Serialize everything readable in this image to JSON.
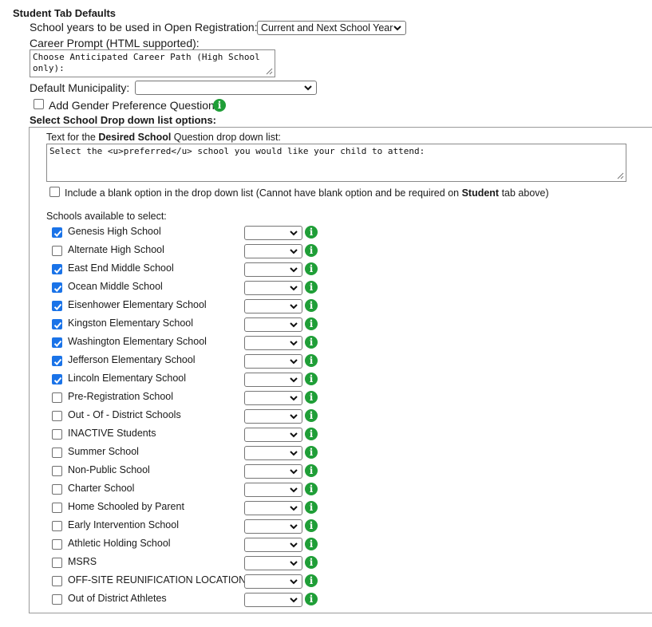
{
  "title": "Student Tab Defaults",
  "school_years": {
    "label": "School years to be used in Open Registration:",
    "selected": "Current and Next School Year"
  },
  "career_prompt": {
    "label": "Career Prompt (HTML supported):",
    "value": "Choose Anticipated Career Path (High School only):"
  },
  "municipality": {
    "label": "Default Municipality:",
    "selected": ""
  },
  "gender_pref": {
    "label": "Add Gender Preference Question",
    "checked": false
  },
  "drop_down_heading": "Select School Drop down list options:",
  "desired_school": {
    "label_pre": "Text for the ",
    "label_bold": "Desired School",
    "label_post": " Question drop down list:",
    "value": "Select the <u>preferred</u> school you would like your child to attend:"
  },
  "blank_option": {
    "label_pre": "Include a blank option in the drop down list (Cannot have blank option and be required on ",
    "label_bold": "Student",
    "label_post": " tab above)",
    "checked": false
  },
  "schools_label": "Schools available to select:",
  "schools": [
    {
      "name": "Genesis High School",
      "checked": true
    },
    {
      "name": "Alternate High School",
      "checked": false
    },
    {
      "name": "East End Middle School",
      "checked": true
    },
    {
      "name": "Ocean Middle School",
      "checked": true
    },
    {
      "name": "Eisenhower Elementary School",
      "checked": true
    },
    {
      "name": "Kingston Elementary School",
      "checked": true
    },
    {
      "name": "Washington Elementary School",
      "checked": true
    },
    {
      "name": "Jefferson Elementary School",
      "checked": true
    },
    {
      "name": "Lincoln Elementary School",
      "checked": true
    },
    {
      "name": "Pre-Registration School",
      "checked": false
    },
    {
      "name": "Out - Of - District Schools",
      "checked": false
    },
    {
      "name": "INACTIVE Students",
      "checked": false
    },
    {
      "name": "Summer School",
      "checked": false
    },
    {
      "name": "Non-Public School",
      "checked": false
    },
    {
      "name": "Charter School",
      "checked": false
    },
    {
      "name": "Home Schooled by Parent",
      "checked": false
    },
    {
      "name": "Early Intervention School",
      "checked": false
    },
    {
      "name": "Athletic Holding School",
      "checked": false
    },
    {
      "name": "MSRS",
      "checked": false
    },
    {
      "name": "OFF-SITE REUNIFICATION LOCATION 1",
      "checked": false
    },
    {
      "name": "Out of District Athletes",
      "checked": false
    }
  ],
  "colors": {
    "accent": "#1a73e8",
    "info_green": "#1f9e37"
  },
  "icons": {
    "info": "info-icon",
    "dropdown": "chevron-down-icon",
    "check": "check-icon"
  }
}
